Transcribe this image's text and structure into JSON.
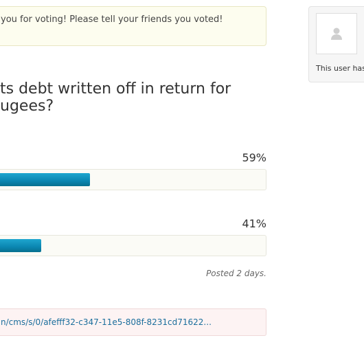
{
  "notice": {
    "text": "you for voting! Please tell your friends you voted!"
  },
  "user_card": {
    "text": "This user has"
  },
  "poll": {
    "question_line1": "ts debt written off in return for",
    "question_line2": "ugees?",
    "options": [
      {
        "percent_label": "59%",
        "percent": 59
      },
      {
        "percent_label": "41%",
        "percent": 41
      }
    ],
    "posted": "Posted 2 days."
  },
  "link": {
    "text": "n/cms/s/0/afefff32-c347-11e5-808f-8231cd71622..."
  },
  "colors": {
    "bar": "#0b86b1",
    "link": "#1b6e9c",
    "notice_bg": "#fdfdef",
    "link_bg": "#fdf3f3"
  }
}
